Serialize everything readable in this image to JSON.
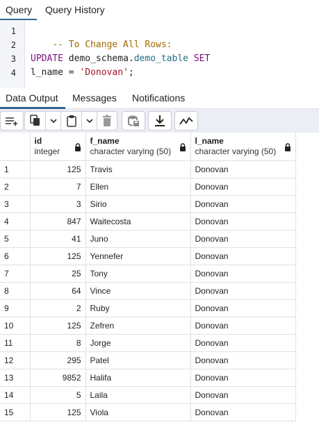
{
  "top_tabs": [
    {
      "label": "Query",
      "active": true
    },
    {
      "label": "Query History",
      "active": false
    }
  ],
  "editor": {
    "line_numbers": [
      "1",
      "2",
      "3",
      "4"
    ],
    "lines": {
      "l1_comment": "-- To Change All Rows:",
      "l3_update": "UPDATE",
      "l3_schema": "demo_schema",
      "l3_dot": ".",
      "l3_table": "demo_table",
      "l3_set": "SET",
      "l4_lhs": "l_name = ",
      "l4_string": "'Donovan'",
      "l4_end": ";"
    }
  },
  "bottom_tabs": [
    {
      "label": "Data Output",
      "active": true
    },
    {
      "label": "Messages",
      "active": false
    },
    {
      "label": "Notifications",
      "active": false
    }
  ],
  "toolbar": {
    "icons": [
      "add-row-icon",
      "copy-icon",
      "chevron-down-icon",
      "paste-icon",
      "chevron-down-icon",
      "delete-icon",
      "save-data-icon",
      "download-icon",
      "graph-icon"
    ]
  },
  "grid": {
    "columns": [
      {
        "name": "id",
        "type": "integer",
        "locked": true
      },
      {
        "name": "f_name",
        "type": "character varying (50)",
        "locked": true
      },
      {
        "name": "l_name",
        "type": "character varying (50)",
        "locked": true
      }
    ],
    "rows": [
      {
        "n": "1",
        "id": "125",
        "f_name": "Travis",
        "l_name": "Donovan"
      },
      {
        "n": "2",
        "id": "7",
        "f_name": "Ellen",
        "l_name": "Donovan"
      },
      {
        "n": "3",
        "id": "3",
        "f_name": "Sirio",
        "l_name": "Donovan"
      },
      {
        "n": "4",
        "id": "847",
        "f_name": "Waitecosta",
        "l_name": "Donovan"
      },
      {
        "n": "5",
        "id": "41",
        "f_name": "Juno",
        "l_name": "Donovan"
      },
      {
        "n": "6",
        "id": "125",
        "f_name": "Yennefer",
        "l_name": "Donovan"
      },
      {
        "n": "7",
        "id": "25",
        "f_name": "Tony",
        "l_name": "Donovan"
      },
      {
        "n": "8",
        "id": "64",
        "f_name": "Vince",
        "l_name": "Donovan"
      },
      {
        "n": "9",
        "id": "2",
        "f_name": "Ruby",
        "l_name": "Donovan"
      },
      {
        "n": "10",
        "id": "125",
        "f_name": "Zefren",
        "l_name": "Donovan"
      },
      {
        "n": "11",
        "id": "8",
        "f_name": "Jorge",
        "l_name": "Donovan"
      },
      {
        "n": "12",
        "id": "295",
        "f_name": "Patel",
        "l_name": "Donovan"
      },
      {
        "n": "13",
        "id": "9852",
        "f_name": "Halifa",
        "l_name": "Donovan"
      },
      {
        "n": "14",
        "id": "5",
        "f_name": "Laila",
        "l_name": "Donovan"
      },
      {
        "n": "15",
        "id": "125",
        "f_name": "Viola",
        "l_name": "Donovan"
      }
    ]
  },
  "colors": {
    "tab_underline": "#326690",
    "comment": "#a36a00",
    "keyword": "#7a0f77",
    "schema": "#1f6e8c",
    "string": "#a8132e"
  }
}
